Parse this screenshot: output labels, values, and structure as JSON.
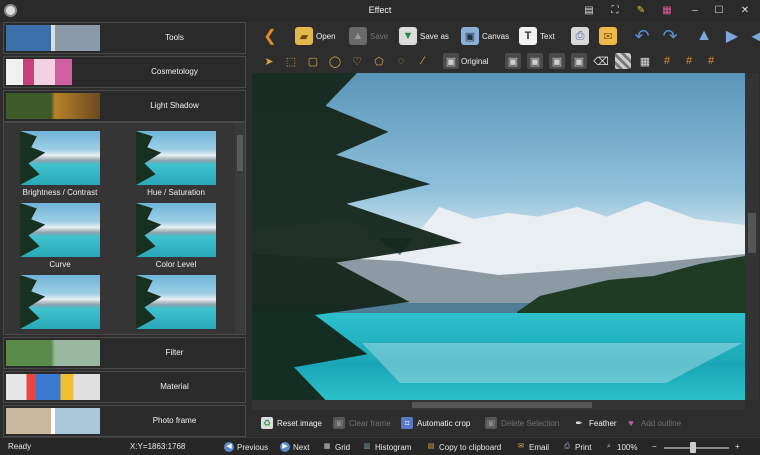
{
  "window": {
    "title": "Effect"
  },
  "categories": [
    {
      "label": "Tools"
    },
    {
      "label": "Cosmetology"
    },
    {
      "label": "Light Shadow"
    },
    {
      "label": "Filter"
    },
    {
      "label": "Material"
    },
    {
      "label": "Photo frame"
    }
  ],
  "effects": [
    {
      "label": "Brightness / Contrast"
    },
    {
      "label": "Hue / Saturation"
    },
    {
      "label": "Curve"
    },
    {
      "label": "Color Level"
    }
  ],
  "toolbar": {
    "open": "Open",
    "save": "Save",
    "save_as": "Save as",
    "canvas": "Canvas",
    "text": "Text",
    "original": "Original"
  },
  "actions": {
    "reset_image": "Reset image",
    "clear_frame": "Clear frame",
    "automatic_crop": "Automatic crop",
    "delete_selection": "Delete Selection",
    "feather": "Feather",
    "add_outline": "Add outline"
  },
  "status": {
    "state": "Ready",
    "coords": "X:Y=1863:1768",
    "previous": "Previous",
    "next": "Next",
    "grid": "Grid",
    "histogram": "Histogram",
    "copy": "Copy to clipboard",
    "email": "Email",
    "print": "Print",
    "zoom": "100%",
    "zoom_minus": "−",
    "zoom_plus": "+"
  },
  "colors": {
    "accent_orange": "#e28a2c",
    "panel": "#2d2d2d",
    "lake": "#2ec0cc"
  }
}
